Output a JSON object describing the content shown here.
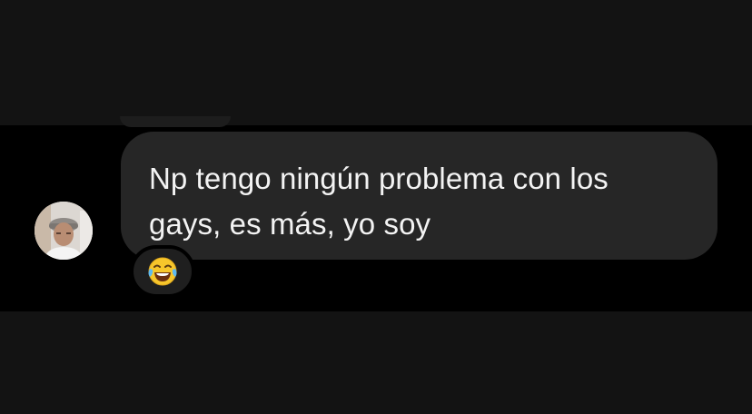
{
  "message": {
    "text": "Np tengo ningún problema con los\ngays, es más, yo soy",
    "bubble_color": "#262626",
    "text_color": "#f3f3f3"
  },
  "reaction": {
    "emoji": "face-with-tears-of-joy",
    "icon_name": "laughing-tears-emoji-icon"
  },
  "sender": {
    "avatar_icon": "profile-avatar"
  },
  "colors": {
    "background": "#000000",
    "reaction_bg": "#1f1f1f"
  }
}
